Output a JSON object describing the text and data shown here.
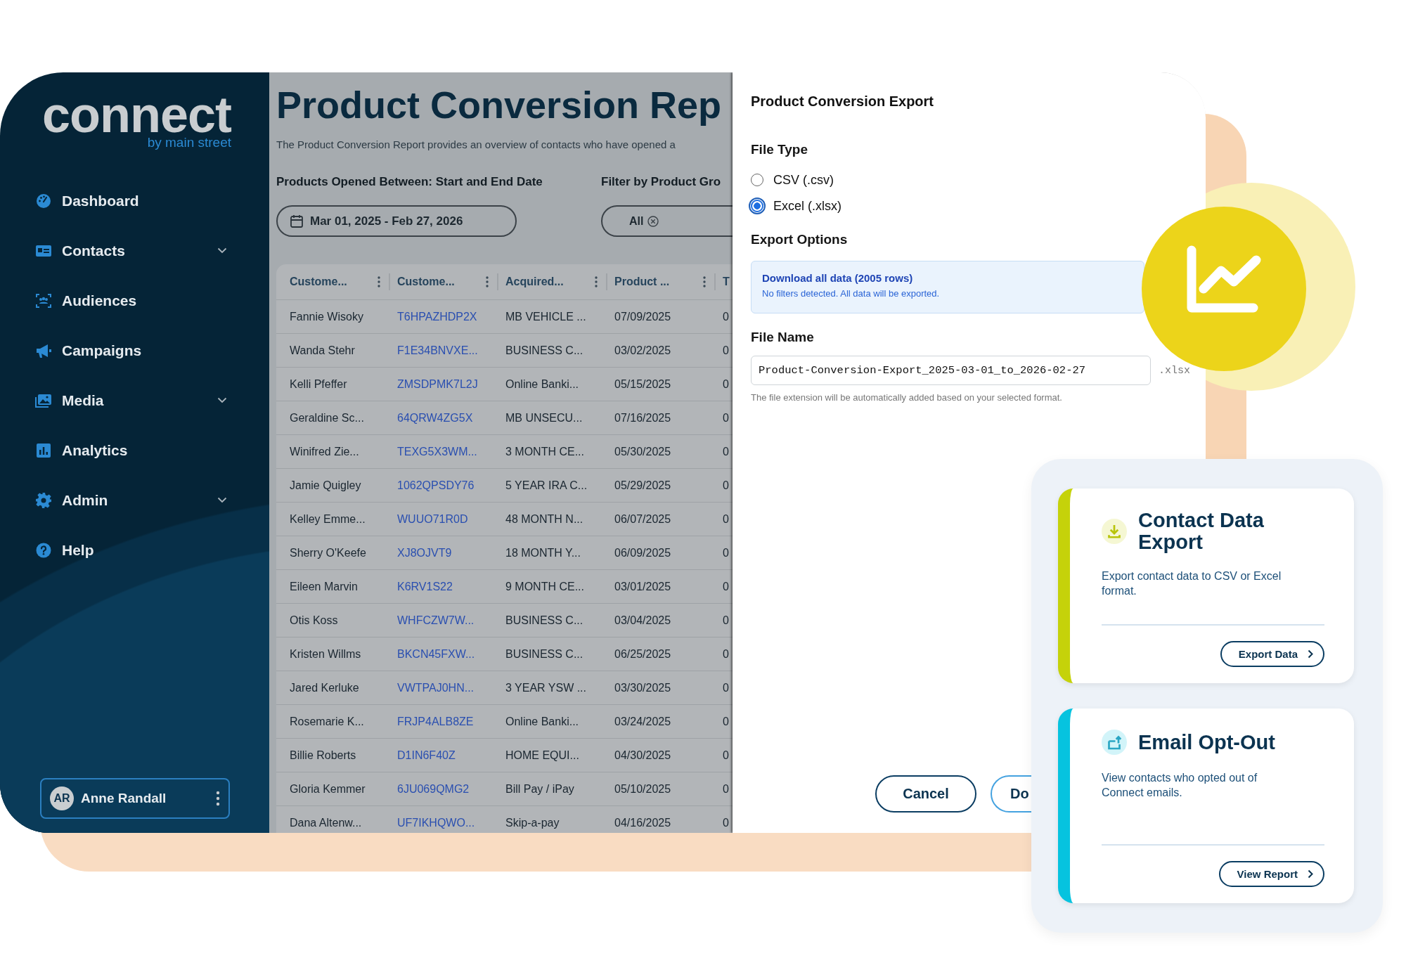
{
  "sidebar": {
    "logo": {
      "wordmark": "connect",
      "tagline": "by main street"
    },
    "nav": [
      {
        "label": "Dashboard",
        "expandable": false
      },
      {
        "label": "Contacts",
        "expandable": true
      },
      {
        "label": "Audiences",
        "expandable": false
      },
      {
        "label": "Campaigns",
        "expandable": false
      },
      {
        "label": "Media",
        "expandable": true
      },
      {
        "label": "Analytics",
        "expandable": false
      },
      {
        "label": "Admin",
        "expandable": true
      },
      {
        "label": "Help",
        "expandable": false
      }
    ],
    "user": {
      "initials": "AR",
      "name": "Anne Randall"
    }
  },
  "report": {
    "title": "Product Conversion Rep",
    "description": "The Product Conversion Report provides an overview of contacts who have opened a",
    "date_filter": {
      "label": "Products Opened Between: Start and End Date",
      "value": "Mar 01, 2025 - Feb 27, 2026"
    },
    "group_filter": {
      "label": "Filter by Product Gro",
      "value": "All"
    },
    "table": {
      "columns": [
        {
          "label": "Custome...",
          "kind": "text"
        },
        {
          "label": "Custome...",
          "kind": "link"
        },
        {
          "label": "Acquired...",
          "kind": "text"
        },
        {
          "label": "Product ...",
          "kind": "text"
        },
        {
          "label": "T",
          "kind": "text"
        }
      ],
      "rows": [
        [
          "Fannie Wisoky",
          "T6HPAZHDP2X",
          "MB VEHICLE ...",
          "07/09/2025",
          "0"
        ],
        [
          "Wanda Stehr",
          "F1E34BNVXE...",
          "BUSINESS C...",
          "03/02/2025",
          "0"
        ],
        [
          "Kelli Pfeffer",
          "ZMSDPMK7L2J",
          "Online Banki...",
          "05/15/2025",
          "0"
        ],
        [
          "Geraldine Sc...",
          "64QRW4ZG5X",
          "MB UNSECU...",
          "07/16/2025",
          "0"
        ],
        [
          "Winifred Zie...",
          "TEXG5X3WM...",
          "3 MONTH CE...",
          "05/30/2025",
          "0"
        ],
        [
          "Jamie Quigley",
          "1062QPSDY76",
          "5 YEAR IRA C...",
          "05/29/2025",
          "0"
        ],
        [
          "Kelley Emme...",
          "WUUO71R0D",
          "48 MONTH N...",
          "06/07/2025",
          "0"
        ],
        [
          "Sherry O'Keefe",
          "XJ8OJVT9",
          "18 MONTH Y...",
          "06/09/2025",
          "0"
        ],
        [
          "Eileen Marvin",
          "K6RV1S22",
          "9 MONTH CE...",
          "03/01/2025",
          "0"
        ],
        [
          "Otis Koss",
          "WHFCZW7W...",
          "BUSINESS C...",
          "03/04/2025",
          "0"
        ],
        [
          "Kristen Willms",
          "BKCN45FXW...",
          "BUSINESS C...",
          "06/25/2025",
          "0"
        ],
        [
          "Jared Kerluke",
          "VWTPAJ0HN...",
          "3 YEAR YSW ...",
          "03/30/2025",
          "0"
        ],
        [
          "Rosemarie K...",
          "FRJP4ALB8ZE",
          "Online Banki...",
          "03/24/2025",
          "0"
        ],
        [
          "Billie Roberts",
          "D1IN6F40Z",
          "HOME EQUI...",
          "04/30/2025",
          "0"
        ],
        [
          "Gloria Kemmer",
          "6JU069QMG2",
          "Bill Pay / iPay",
          "05/10/2025",
          "0"
        ],
        [
          "Dana Altenw...",
          "UF7IKHQWO...",
          "Skip-a-pay",
          "04/16/2025",
          "0"
        ]
      ]
    }
  },
  "export_dialog": {
    "title": "Product Conversion Export",
    "file_type_label": "File Type",
    "file_types": [
      {
        "label": "CSV (.csv)",
        "selected": false
      },
      {
        "label": "Excel (.xlsx)",
        "selected": true
      }
    ],
    "options_label": "Export Options",
    "option": {
      "title": "Download all data (2005 rows)",
      "note": "No filters detected. All data will be exported."
    },
    "file_name_label": "File Name",
    "file_name": "Product-Conversion-Export_2025-03-01_to_2026-02-27",
    "extension": ".xlsx",
    "hint": "The file extension will be automatically added based on your selected format.",
    "buttons": [
      {
        "label": "Cancel",
        "kind": "secondary"
      },
      {
        "label": "Do",
        "kind": "primary"
      }
    ]
  },
  "tool_cards": [
    {
      "title": "Contact Data Export",
      "description": "Export contact data to CSV or Excel format.",
      "button": "Export Data",
      "color": "#c5d20a"
    },
    {
      "title": "Email Opt-Out",
      "description": "View contacts who opted out of Connect emails.",
      "button": "View Report",
      "color": "#06c3df"
    }
  ]
}
